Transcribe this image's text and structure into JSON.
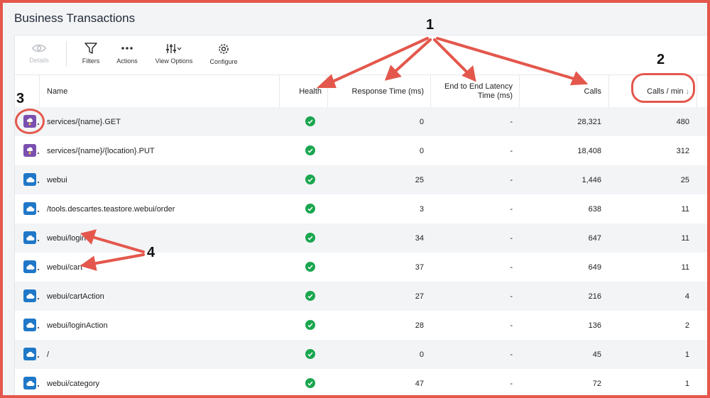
{
  "page": {
    "title": "Business Transactions"
  },
  "toolbar": {
    "details": "Details",
    "filters": "Filters",
    "actions": "Actions",
    "view_options": "View Options",
    "configure": "Configure"
  },
  "columns": {
    "name": "Name",
    "health": "Health",
    "response_time": "Response Time (ms)",
    "e2e_latency_line1": "End to End Latency",
    "e2e_latency_line2": "Time (ms)",
    "calls": "Calls",
    "calls_per_min": "Calls / min",
    "sort_indicator": "↓"
  },
  "rows": [
    {
      "type_icon": "purple-service-icon",
      "name": "services/{name}.GET",
      "health": "green-check-icon",
      "response_time": "0",
      "e2e": "-",
      "calls": "28,321",
      "calls_per_min": "480"
    },
    {
      "type_icon": "purple-service-icon",
      "name": "services/{name}/{location}.PUT",
      "health": "green-check-icon",
      "response_time": "0",
      "e2e": "-",
      "calls": "18,408",
      "calls_per_min": "312"
    },
    {
      "type_icon": "cloud-icon",
      "name": "webui",
      "health": "green-check-icon",
      "response_time": "25",
      "e2e": "-",
      "calls": "1,446",
      "calls_per_min": "25"
    },
    {
      "type_icon": "cloud-icon",
      "name": "/tools.descartes.teastore.webui/order",
      "health": "green-check-icon",
      "response_time": "3",
      "e2e": "-",
      "calls": "638",
      "calls_per_min": "11"
    },
    {
      "type_icon": "cloud-icon",
      "name": "webui/login",
      "health": "green-check-icon",
      "response_time": "34",
      "e2e": "-",
      "calls": "647",
      "calls_per_min": "11"
    },
    {
      "type_icon": "cloud-icon",
      "name": "webui/cart",
      "health": "green-check-icon",
      "response_time": "37",
      "e2e": "-",
      "calls": "649",
      "calls_per_min": "11"
    },
    {
      "type_icon": "cloud-icon",
      "name": "webui/cartAction",
      "health": "green-check-icon",
      "response_time": "27",
      "e2e": "-",
      "calls": "216",
      "calls_per_min": "4"
    },
    {
      "type_icon": "cloud-icon",
      "name": "webui/loginAction",
      "health": "green-check-icon",
      "response_time": "28",
      "e2e": "-",
      "calls": "136",
      "calls_per_min": "2"
    },
    {
      "type_icon": "cloud-icon",
      "name": "/",
      "health": "green-check-icon",
      "response_time": "0",
      "e2e": "-",
      "calls": "45",
      "calls_per_min": "1"
    },
    {
      "type_icon": "cloud-icon",
      "name": "webui/category",
      "health": "green-check-icon",
      "response_time": "47",
      "e2e": "-",
      "calls": "72",
      "calls_per_min": "1"
    }
  ],
  "annotations": {
    "a1": "1",
    "a2": "2",
    "a3": "3",
    "a4": "4"
  },
  "colors": {
    "annotation_red": "#e4574c",
    "health_green": "#1aa64f",
    "service_purple": "#7a4fb0",
    "cloud_blue": "#1f78c8"
  }
}
